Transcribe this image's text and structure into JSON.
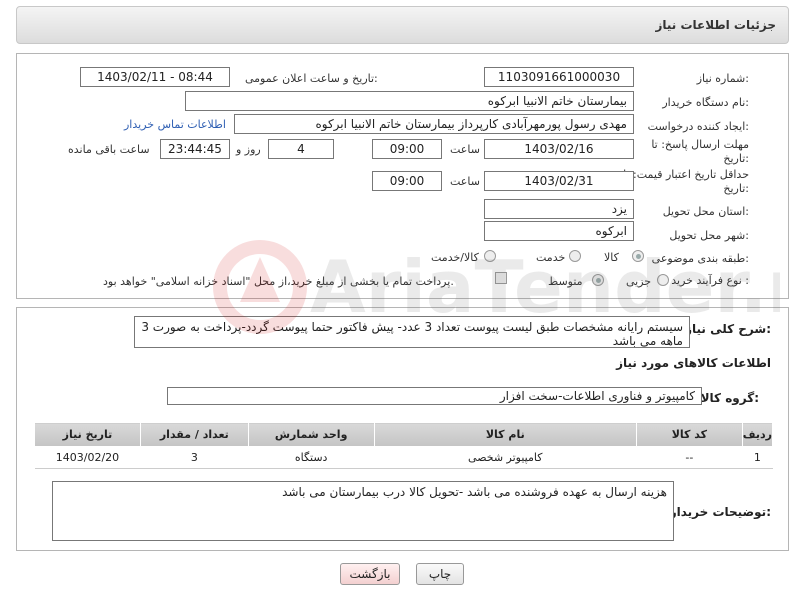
{
  "header": {
    "title": "جزئیات اطلاعات نیاز"
  },
  "form": {
    "need_number_label": "شماره نیاز:",
    "need_number": "1103091661000030",
    "announce_label": "تاریخ و ساعت اعلان عمومی:",
    "announce_value": "1403/02/11 - 08:44",
    "buyer_org_label": "نام دستگاه خریدار:",
    "buyer_org": "بیمارستان خاتم الانبیا ابرکوه",
    "creator_label": "ایجاد کننده درخواست:",
    "creator": "مهدی رسول پورمهرآبادی کارپرداز بیمارستان خاتم الانبیا ابرکوه",
    "contact_link": "اطلاعات تماس خریدار",
    "reply_deadline_label": "مهلت ارسال پاسخ: تا تاریخ:",
    "reply_date": "1403/02/16",
    "time_label": "ساعت",
    "reply_time": "09:00",
    "days_value": "4",
    "days_label": "روز و",
    "remaining_time": "23:44:45",
    "remaining_label": "ساعت باقی مانده",
    "price_validity_label": "حداقل تاریخ اعتبار قیمت: تا تاریخ:",
    "price_date": "1403/02/31",
    "price_time": "09:00",
    "province_label": "استان محل تحویل:",
    "province": "یزد",
    "city_label": "شهر محل تحویل:",
    "city": "ابرکوه",
    "category_label": "طبقه بندی موضوعی:",
    "category_options": [
      "کالا",
      "خدمت",
      "کالا/خدمت"
    ],
    "process_label": "نوع فرآیند خرید :",
    "process_options": [
      "جزیی",
      "متوسط"
    ],
    "payment_note": "پرداخت تمام یا بخشی از مبلغ خرید،از محل \"اسناد خزانه اسلامی\" خواهد بود."
  },
  "details": {
    "description_label": "شرح کلی نیاز:",
    "description": "سیستم رایانه مشخصات طبق لیست پیوست تعداد 3 عدد- پیش فاکتور حتما پیوست گردد-پرداخت به صورت 3 ماهه می باشد",
    "goods_info_title": "اطلاعات کالاهای مورد نیاز",
    "goods_group_label": "گروه کالا:",
    "goods_group": "کامپیوتر و فناوری اطلاعات-سخت افزار",
    "table": {
      "headers": [
        "ردیف",
        "کد کالا",
        "نام کالا",
        "واحد شمارش",
        "تعداد / مقدار",
        "تاریخ نیاز"
      ],
      "rows": [
        [
          "1",
          "--",
          "کامپیوتر شخصی",
          "دستگاه",
          "3",
          "1403/02/20"
        ]
      ]
    },
    "buyer_notes_label": "توضیحات خریدار:",
    "buyer_notes": "هزینه ارسال به عهده فروشنده می باشد -تحویل کالا درب بیمارستان می باشد"
  },
  "buttons": {
    "print": "چاپ",
    "back": "بازگشت"
  },
  "watermark_text": "AriaTender.neT"
}
